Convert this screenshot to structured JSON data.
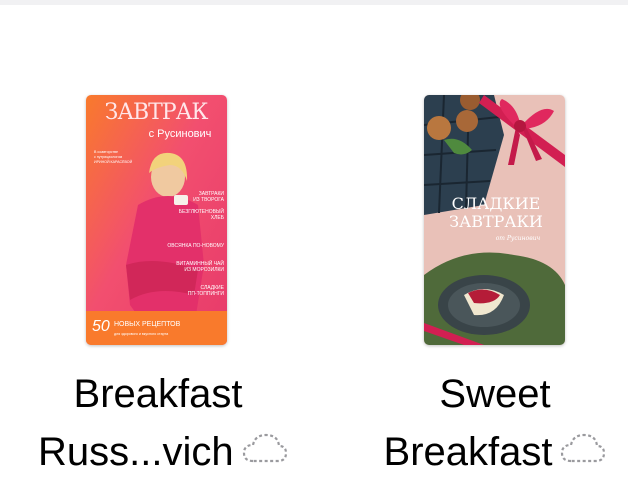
{
  "books": [
    {
      "title_line1": "Breakfast",
      "title_line2": "Russ...vich",
      "cover": {
        "title": "ЗАВТРАК",
        "subtitle": "с Русинович",
        "intro_lines": [
          "В соавторстве",
          "с нутрициологом",
          "ИРИНОЙ КАРАСЁВОЙ"
        ],
        "menu_lines": [
          "ЗАВТРАКИ",
          "ИЗ ТВОРОГА",
          "БЕЗГЛЮТЕНОВЫЙ",
          "ХЛЕБ",
          "ОВСЯНКА ПО-НОВОМУ",
          "ВИТАМИННЫЙ ЧАЙ",
          "ИЗ МОРОЗИЛКИ",
          "СЛАДКИЕ",
          "ПП-ТОППИНГИ"
        ],
        "banner_number": "50",
        "banner_text": "НОВЫХ РЕЦЕПТОВ",
        "banner_subtext": "для здорового и вкусного старта"
      },
      "status_icon": "icloud-download-icon"
    },
    {
      "title_line1": "Sweet",
      "title_line2": "Breakfast",
      "cover": {
        "title_line1": "СЛАДКИЕ",
        "title_line2": "ЗАВТРАКИ",
        "subtitle": "от Русинович"
      },
      "status_icon": "icloud-download-icon"
    }
  ],
  "colors": {
    "cover1_bg": "#f04f78",
    "cover1_accent": "#f97a2c",
    "cover2_bg": "#e9c1b8",
    "ribbon": "#d21f52"
  }
}
